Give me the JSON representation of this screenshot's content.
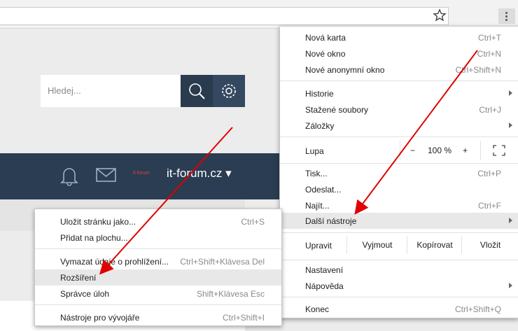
{
  "search": {
    "placeholder": "Hledej..."
  },
  "site": {
    "name": "it-forum.cz",
    "logo_small": "it-forum"
  },
  "chrome_menu": {
    "new_group": [
      {
        "label": "Nová karta",
        "shortcut": "Ctrl+T"
      },
      {
        "label": "Nové okno",
        "shortcut": "Ctrl+N"
      },
      {
        "label": "Nové anonymní okno",
        "shortcut": "Ctrl+Shift+N"
      }
    ],
    "history_group": [
      {
        "label": "Historie",
        "shortcut": ""
      },
      {
        "label": "Stažené soubory",
        "shortcut": "Ctrl+J"
      },
      {
        "label": "Záložky",
        "shortcut": ""
      }
    ],
    "zoom": {
      "label": "Lupa",
      "minus": "−",
      "value": "100 %",
      "plus": "+"
    },
    "tools_group": [
      {
        "label": "Tisk...",
        "shortcut": "Ctrl+P"
      },
      {
        "label": "Odeslat...",
        "shortcut": ""
      },
      {
        "label": "Najít...",
        "shortcut": "Ctrl+F"
      },
      {
        "label": "Další nástroje",
        "shortcut": ""
      }
    ],
    "edit": {
      "label": "Upravit",
      "cut": "Vyjmout",
      "copy": "Kopírovat",
      "paste": "Vložit"
    },
    "settings_group": [
      {
        "label": "Nastavení",
        "shortcut": ""
      },
      {
        "label": "Nápověda",
        "shortcut": ""
      }
    ],
    "exit": {
      "label": "Konec",
      "shortcut": "Ctrl+Shift+Q"
    }
  },
  "more_tools_menu": [
    {
      "label": "Uložit stránku jako...",
      "shortcut": "Ctrl+S"
    },
    {
      "label": "Přidat na plochu...",
      "shortcut": ""
    },
    {
      "label": "Vymazat údaje o prohlížení...",
      "shortcut": "Ctrl+Shift+Klávesa Del"
    },
    {
      "label": "Rozšíření",
      "shortcut": ""
    },
    {
      "label": "Správce úloh",
      "shortcut": "Shift+Klávesa Esc"
    },
    {
      "label": "Nástroje pro vývojáře",
      "shortcut": "Ctrl+Shift+I"
    }
  ],
  "colors": {
    "arrow": "#e00000",
    "navbar": "#2a3d52"
  }
}
